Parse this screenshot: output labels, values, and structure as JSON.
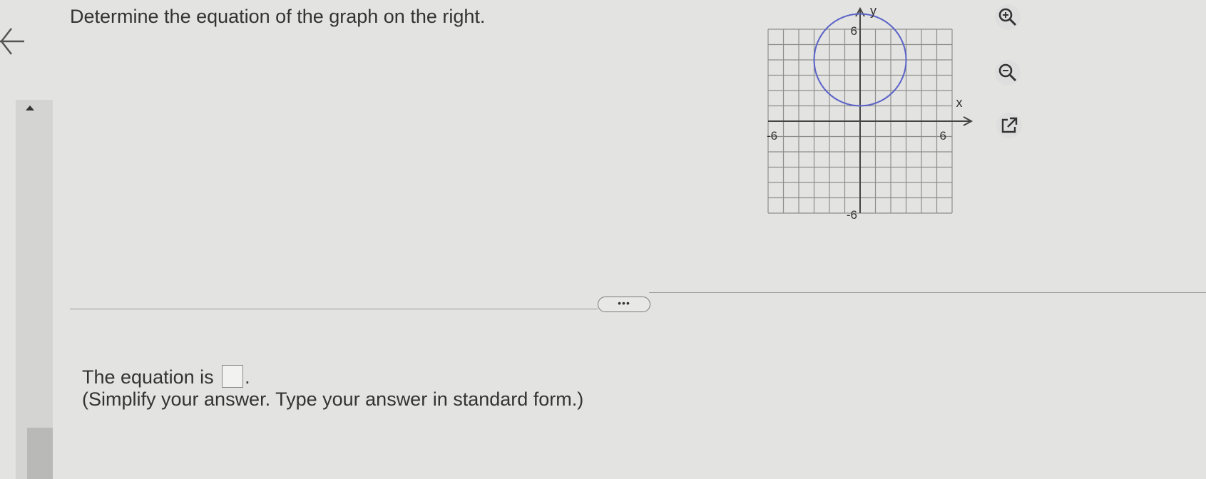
{
  "question": {
    "text": "Determine the equation of the graph on the right."
  },
  "chart_data": {
    "type": "scatter",
    "title": "",
    "xlabel": "x",
    "ylabel": "y",
    "xlim": [
      -6,
      6
    ],
    "ylim": [
      -6,
      6
    ],
    "grid": true,
    "tick_labels": {
      "x_min": "-6",
      "x_max": "6",
      "y_max": "6",
      "y_min": "-6"
    },
    "circle": {
      "center": [
        0,
        4
      ],
      "radius": 3
    }
  },
  "tools": {
    "zoom_in_icon": "zoom-in-icon",
    "zoom_out_icon": "zoom-out-icon",
    "popout_icon": "external-link-icon"
  },
  "more_button": {
    "label": "•••"
  },
  "answer": {
    "prefix": "The equation is",
    "suffix": ".",
    "value": "",
    "instruction": "(Simplify your answer. Type your answer in standard form.)"
  },
  "colors": {
    "curve": "#5a63c8",
    "grid": "#8e8e8c"
  }
}
